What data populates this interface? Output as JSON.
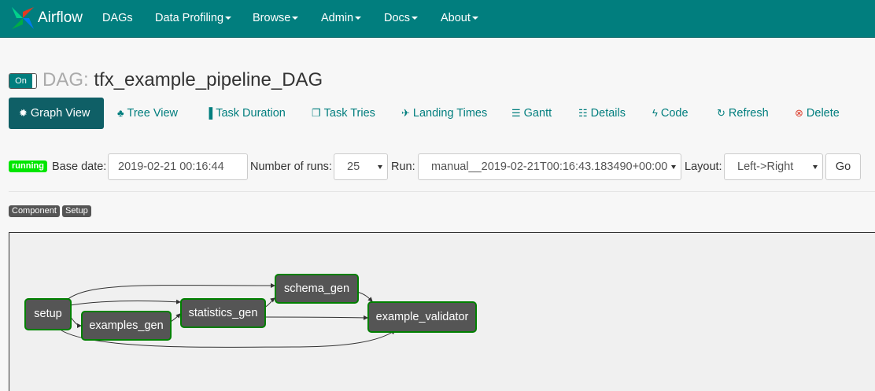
{
  "navbar": {
    "brand": "Airflow",
    "items": [
      "DAGs",
      "Data Profiling",
      "Browse",
      "Admin",
      "Docs",
      "About"
    ]
  },
  "dag": {
    "toggle": "On",
    "title_prefix": "DAG:",
    "name": "tfx_example_pipeline_DAG"
  },
  "tabs": [
    {
      "label": "Graph View",
      "icon": "asterisk-icon",
      "active": true
    },
    {
      "label": "Tree View",
      "icon": "tree-icon"
    },
    {
      "label": "Task Duration",
      "icon": "bar-chart-icon"
    },
    {
      "label": "Task Tries",
      "icon": "duplicate-icon"
    },
    {
      "label": "Landing Times",
      "icon": "plane-icon"
    },
    {
      "label": "Gantt",
      "icon": "align-left-icon"
    },
    {
      "label": "Details",
      "icon": "list-icon"
    },
    {
      "label": "Code",
      "icon": "flash-icon"
    },
    {
      "label": "Refresh",
      "icon": "refresh-icon"
    },
    {
      "label": "Delete",
      "icon": "remove-circle-icon"
    }
  ],
  "controls": {
    "status": "running",
    "base_date_label": "Base date:",
    "base_date_value": "2019-02-21 00:16:44",
    "num_runs_label": "Number of runs:",
    "num_runs_value": "25",
    "run_label": "Run:",
    "run_value": "manual__2019-02-21T00:16:43.183490+00:00",
    "layout_label": "Layout:",
    "layout_value": "Left->Right",
    "go_label": "Go"
  },
  "legend": [
    "Component",
    "Setup"
  ],
  "graph": {
    "nodes": [
      "setup",
      "examples_gen",
      "statistics_gen",
      "schema_gen",
      "example_validator"
    ],
    "edges": [
      [
        "setup",
        "examples_gen"
      ],
      [
        "setup",
        "statistics_gen"
      ],
      [
        "setup",
        "schema_gen"
      ],
      [
        "setup",
        "example_validator"
      ],
      [
        "examples_gen",
        "statistics_gen"
      ],
      [
        "statistics_gen",
        "schema_gen"
      ],
      [
        "statistics_gen",
        "example_validator"
      ],
      [
        "schema_gen",
        "example_validator"
      ]
    ],
    "status_color": "#008000"
  }
}
